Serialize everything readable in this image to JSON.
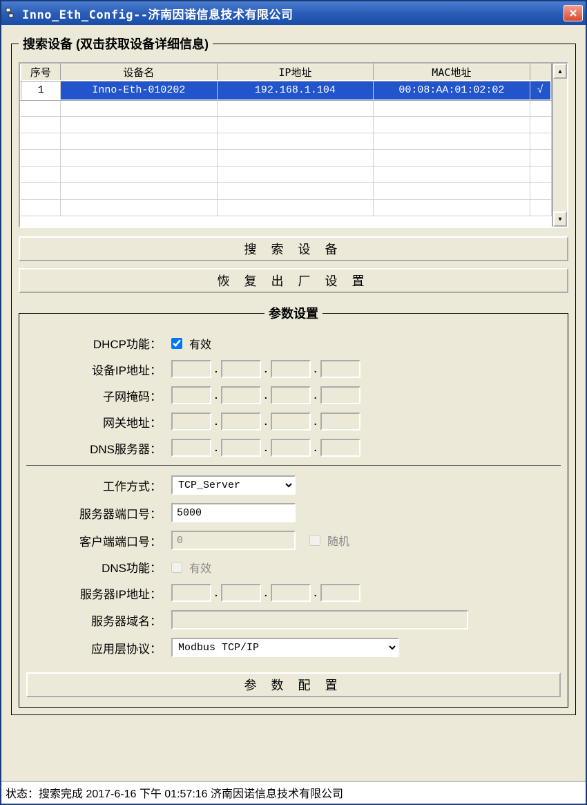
{
  "title": "Inno_Eth_Config--济南因诺信息技术有限公司",
  "search_group": {
    "legend": "搜索设备 (双击获取设备详细信息)",
    "headers": {
      "seq": "序号",
      "name": "设备名",
      "ip": "IP地址",
      "mac": "MAC地址"
    },
    "rows": [
      {
        "seq": "1",
        "name": "Inno-Eth-010202",
        "ip": "192.168.1.104",
        "mac": "00:08:AA:01:02:02",
        "chk": "√"
      }
    ],
    "search_btn": "搜 索 设 备",
    "restore_btn": "恢 复 出 厂 设 置"
  },
  "params_group": {
    "legend": "参数设置",
    "dhcp_label": "DHCP功能：",
    "dhcp_chk": "有效",
    "device_ip_label": "设备IP地址：",
    "subnet_label": "子网掩码：",
    "gateway_label": "网关地址：",
    "dns_server_label": "DNS服务器：",
    "work_mode_label": "工作方式：",
    "work_mode_value": "TCP_Server",
    "server_port_label": "服务器端口号：",
    "server_port_value": "5000",
    "client_port_label": "客户端端口号：",
    "client_port_value": "0",
    "random_label": "随机",
    "dns_func_label": "DNS功能：",
    "dns_func_chk": "有效",
    "server_ip_label": "服务器IP地址：",
    "server_domain_label": "服务器域名：",
    "app_proto_label": "应用层协议：",
    "app_proto_value": "Modbus TCP/IP",
    "config_btn": "参 数 配 置"
  },
  "status": "状态：搜索完成    2017-6-16   下午 01:57:16 济南因诺信息技术有限公司"
}
